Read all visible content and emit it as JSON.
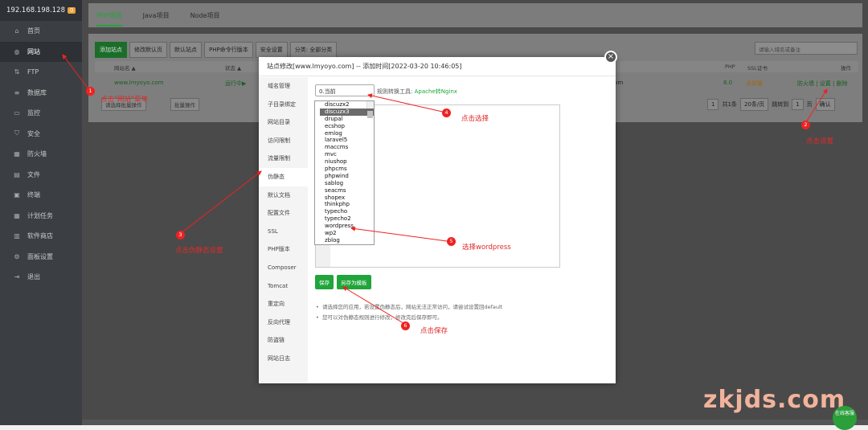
{
  "sidebar": {
    "server_ip": "192.168.198.128",
    "badge": "0",
    "items": [
      {
        "label": "首页",
        "icon": "home-icon"
      },
      {
        "label": "网站",
        "icon": "globe-icon"
      },
      {
        "label": "FTP",
        "icon": "ftp-icon"
      },
      {
        "label": "数据库",
        "icon": "database-icon"
      },
      {
        "label": "监控",
        "icon": "monitor-icon"
      },
      {
        "label": "安全",
        "icon": "shield-icon"
      },
      {
        "label": "防火墙",
        "icon": "firewall-icon"
      },
      {
        "label": "文件",
        "icon": "folder-icon"
      },
      {
        "label": "终端",
        "icon": "terminal-icon"
      },
      {
        "label": "计划任务",
        "icon": "calendar-icon"
      },
      {
        "label": "软件商店",
        "icon": "store-icon"
      },
      {
        "label": "面板设置",
        "icon": "settings-icon"
      },
      {
        "label": "退出",
        "icon": "logout-icon"
      }
    ]
  },
  "tabs": [
    "PHP项目",
    "Java项目",
    "Node项目"
  ],
  "toolbar": [
    "添加站点",
    "修改默认页",
    "默认站点",
    "PHP命令行版本",
    "安全设置",
    "分类: 全部分类"
  ],
  "search_placeholder": "请输入域名或备注",
  "table": {
    "headers": {
      "name": "网站名 ▲",
      "status": "状态 ▲",
      "php": "PHP",
      "ssl": "SSL证书",
      "action": "操作"
    },
    "row": {
      "name": "www.lmyoyo.com",
      "status": "运行中▶",
      "domain_tail": ".com",
      "php": "8.0",
      "ssl": "未部署",
      "actions": "防火墙 | 设置 | 删除"
    },
    "batch_select": "请选择批量操作",
    "batch_btn": "批量操作"
  },
  "pagination": {
    "page": "1",
    "total": "共1条",
    "per_page": "20条/页",
    "jump": "跳转到",
    "jump_val": "1",
    "page_unit": "页",
    "confirm": "确认"
  },
  "modal": {
    "title": "站点修改[www.lmyoyo.com] -- 添加时间[2022-03-20 10:46:05]",
    "nav": [
      "域名管理",
      "子目录绑定",
      "网站目录",
      "访问限制",
      "流量限制",
      "伪静态",
      "默认文档",
      "配置文件",
      "SSL",
      "PHP版本",
      "Composer",
      "Tomcat",
      "重定向",
      "反向代理",
      "防盗链",
      "网站日志"
    ],
    "select_value": "0.当前",
    "convert_label": "规则转换工具:",
    "convert_link": "Apache转Nginx",
    "dropdown": [
      "discuzx2",
      "discuzx3",
      "drupal",
      "ecshop",
      "emlog",
      "laravel5",
      "maccms",
      "mvc",
      "niushop",
      "phpcms",
      "phpwind",
      "sablog",
      "seacms",
      "shopex",
      "thinkphp",
      "typecho",
      "typecho2",
      "wordpress",
      "wp2",
      "zblog"
    ],
    "selected": "discuzx3",
    "save": "保存",
    "save_template": "另存为模板",
    "tips": [
      "请选择您的应用，若设置伪静态后，网站无法正常访问，请尝试设置回default",
      "您可以对伪静态规则进行修改，修改完后保存即可。"
    ]
  },
  "annotations": [
    {
      "num": "1",
      "text": "点击\"网站\"菜单"
    },
    {
      "num": "2",
      "text": "点击设置"
    },
    {
      "num": "3",
      "text": "点击伪静态设置"
    },
    {
      "num": "4",
      "text": "点击选择"
    },
    {
      "num": "5",
      "text": "选择wordpress"
    },
    {
      "num": "6",
      "text": "点击保存"
    }
  ],
  "watermark": "zkjds.com",
  "online_service": "在线客服"
}
